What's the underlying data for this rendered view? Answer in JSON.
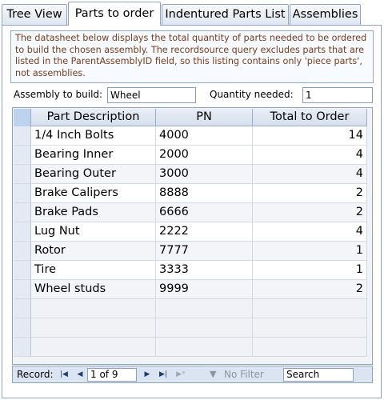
{
  "tabs": [
    "Tree View",
    "Parts to order",
    "Indentured Parts List",
    "Assemblies"
  ],
  "info_text": "The datasheet below displays the total quantity of parts needed to be ordered to build the chosen assembly.  The recordsource query excludes parts that are listed in the ParentAssemblyID field, so this listing contains only 'piece parts', not assemblies.",
  "form": {
    "assembly_label": "Assembly to build:",
    "assembly_value": "Wheel",
    "quantity_label": "Quantity needed:",
    "quantity_value": "1"
  },
  "grid": {
    "columns": [
      "Part Description",
      "PN",
      "Total to Order"
    ],
    "rows": [
      [
        "1/4 Inch Bolts",
        "4000",
        "14"
      ],
      [
        "Bearing Inner",
        "2000",
        "4"
      ],
      [
        "Bearing Outer",
        "3000",
        "4"
      ],
      [
        "Brake Calipers",
        "8888",
        "2"
      ],
      [
        "Brake Pads",
        "6666",
        "2"
      ],
      [
        "Lug Nut",
        "2222",
        "4"
      ],
      [
        "Rotor",
        "7777",
        "1"
      ],
      [
        "Tire",
        "3333",
        "1"
      ],
      [
        "Wheel studs",
        "9999",
        "2"
      ]
    ]
  },
  "nav": {
    "record_label": "Record:",
    "record_position": "1 of 9",
    "filter_label": "No Filter",
    "search_label": "Search"
  }
}
